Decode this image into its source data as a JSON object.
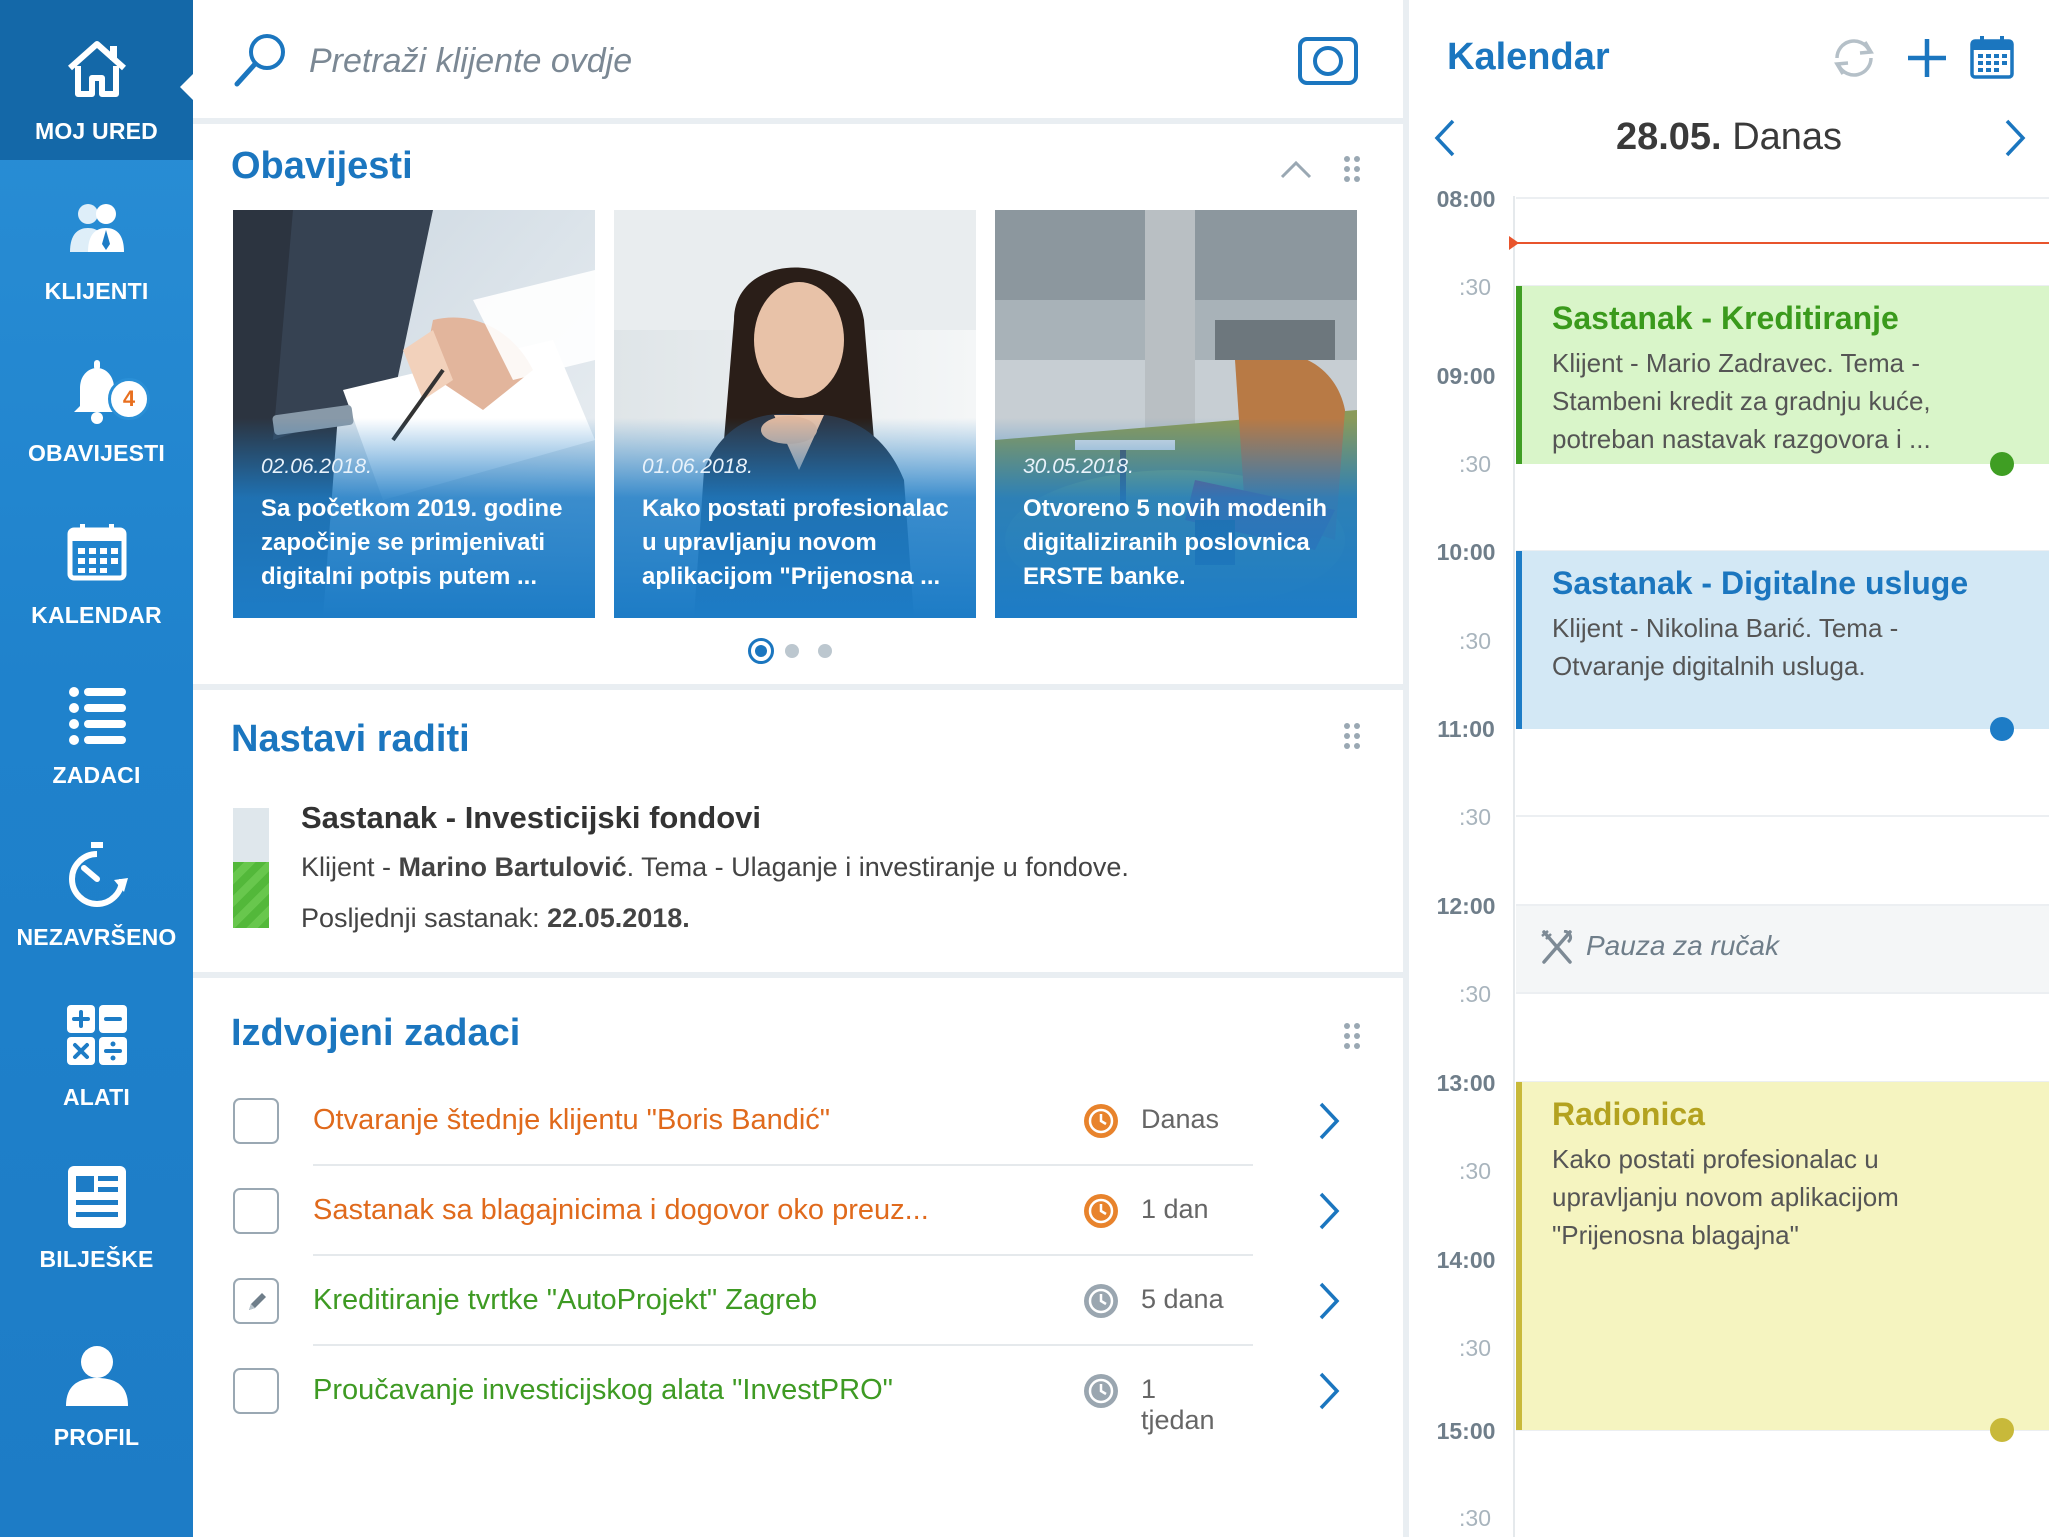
{
  "sidebar": {
    "items": [
      {
        "label": "MOJ URED",
        "icon": "home-icon"
      },
      {
        "label": "KLIJENTI",
        "icon": "users-icon"
      },
      {
        "label": "OBAVIJESTI",
        "icon": "bell-icon",
        "badge": "4"
      },
      {
        "label": "KALENDAR",
        "icon": "calendar-icon"
      },
      {
        "label": "ZADACI",
        "icon": "list-icon"
      },
      {
        "label": "NEZAVRŠENO",
        "icon": "stopwatch-icon"
      },
      {
        "label": "ALATI",
        "icon": "calculator-icon"
      },
      {
        "label": "BILJEŠKE",
        "icon": "notes-icon"
      },
      {
        "label": "PROFIL",
        "icon": "profile-icon"
      }
    ]
  },
  "search": {
    "placeholder": "Pretraži klijente ovdje"
  },
  "notifications": {
    "title": "Obavijesti",
    "cards": [
      {
        "date": "02.06.2018.",
        "text": "Sa početkom 2019. godine započinje se primjenivati digitalni potpis putem ..."
      },
      {
        "date": "01.06.2018.",
        "text": "Kako postati profesionalac u upravljanju novom aplikacijom \"Prijenosna ..."
      },
      {
        "date": "30.05.2018.",
        "text": "Otvoreno 5 novih modenih digitaliziranih poslovnica ERSTE banke."
      }
    ],
    "active_page": 1,
    "page_count": 3
  },
  "continue": {
    "title": "Nastavi raditi",
    "meeting_title": "Sastanak - Investicijski fondovi",
    "client_prefix": "Klijent - ",
    "client_name": "Marino Bartulović",
    "topic": ". Tema - Ulaganje i investiranje u fondove.",
    "last_label": "Posljednji sastanak: ",
    "last_date": "22.05.2018.",
    "progress": 0.55
  },
  "tasks": {
    "title": "Izdvojeni zadaci",
    "items": [
      {
        "title": "Otvaranje štednje klijentu \"Boris Bandić\"",
        "due": "Danas",
        "color": "#e06a1c",
        "clock": "#e8832c",
        "state": "empty"
      },
      {
        "title": "Sastanak sa blagajnicima i dogovor oko preuz...",
        "due": "1 dan",
        "color": "#e06a1c",
        "clock": "#e8832c",
        "state": "empty"
      },
      {
        "title": "Kreditiranje tvrtke \"AutoProjekt\" Zagreb",
        "due": "5 dana",
        "color": "#3e9a23",
        "clock": "#9aa6b0",
        "state": "edit"
      },
      {
        "title": "Proučavanje investicijskog alata \"InvestPRO\"",
        "due": "1 tjedan",
        "color": "#3e9a23",
        "clock": "#9aa6b0",
        "state": "empty"
      }
    ]
  },
  "calendar": {
    "title": "Kalendar",
    "date": "28.05.",
    "today_label": "Danas",
    "hours": [
      "08:00",
      "09:00",
      "10:00",
      "11:00",
      "12:00",
      "13:00",
      "14:00",
      "15:00"
    ],
    "half_label": ":30",
    "events": [
      {
        "title": "Sastanak - Kreditiranje",
        "desc": "Klijent - Mario Zadravec. Tema - Stambeni kredit za gradnju kuće, potreban nastavak razgovora i ...",
        "bg": "#d9f5c9",
        "bar": "#3f9e23",
        "title_color": "#3a9a1c",
        "dot": "#3f9e23"
      },
      {
        "title": "Sastanak - Digitalne usluge",
        "desc": "Klijent - Nikolina Barić. Tema - Otvaranje digitalnih usluga.",
        "bg": "#d3e8f5",
        "bar": "#1d7cc6",
        "title_color": "#1b76bf",
        "dot": "#1d7cc6"
      },
      {
        "title": "Radionica",
        "desc": "Kako postati profesionalac u upravljanju novom aplikacijom \"Prijenosna blagajna\"",
        "bg": "#f5f4c0",
        "bar": "#c8b93a",
        "title_color": "#b3a21f",
        "dot": "#c8b93a"
      }
    ],
    "lunch": "Pauza za ručak"
  },
  "colors": {
    "accent": "#1b76bf",
    "sidebar": "#1d7cc6",
    "now_line": "#e8542c"
  }
}
